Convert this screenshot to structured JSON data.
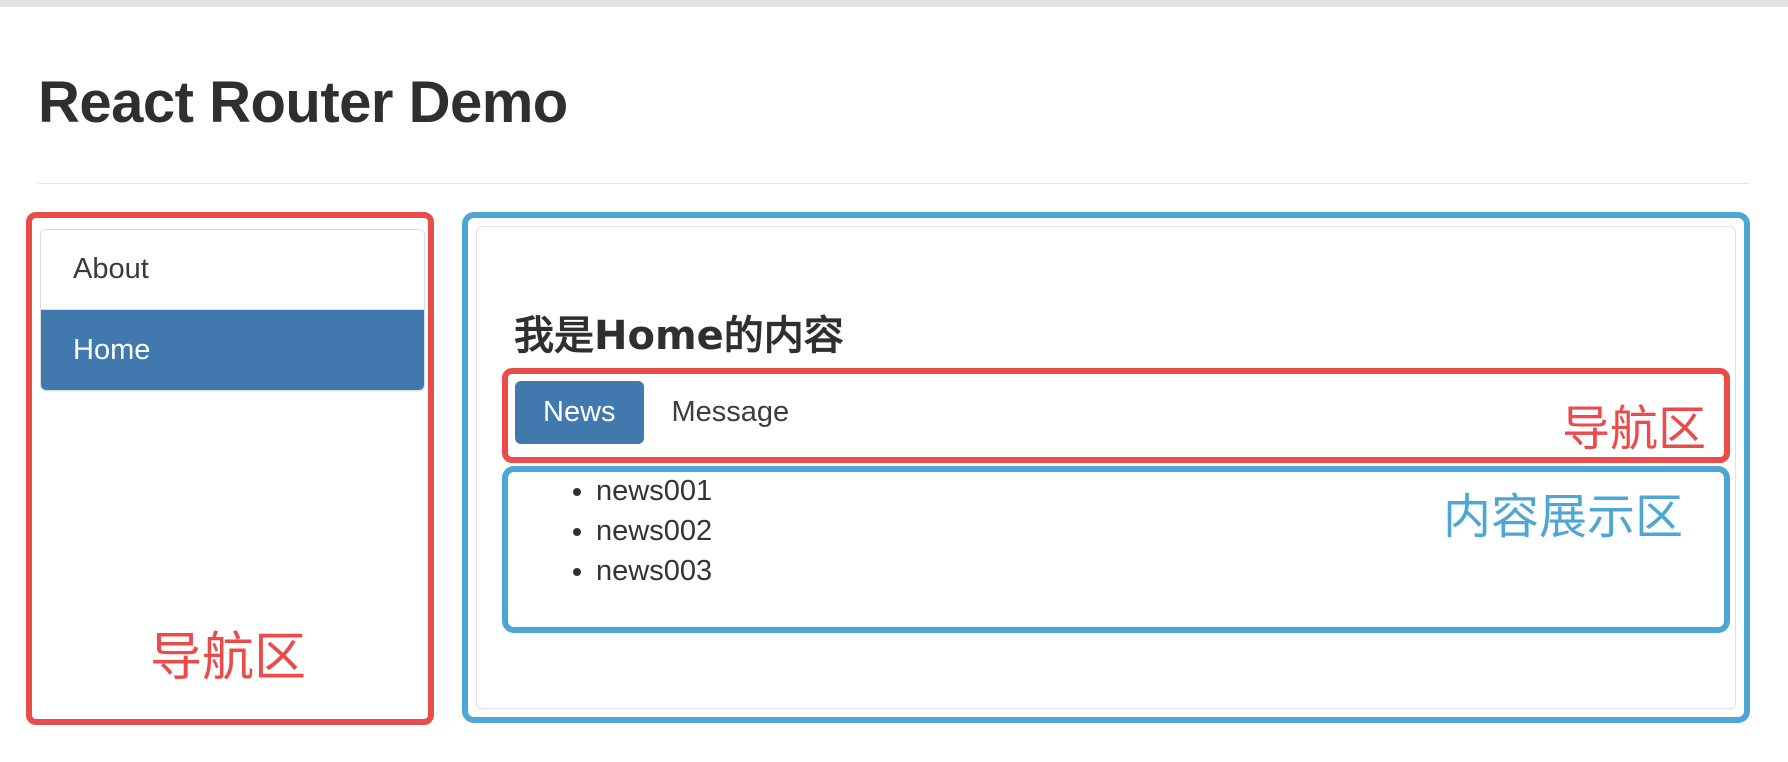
{
  "header": {
    "title": "React Router Demo"
  },
  "sidebar": {
    "items": [
      {
        "label": "About",
        "active": false
      },
      {
        "label": "Home",
        "active": true
      }
    ]
  },
  "content": {
    "heading": "我是Home的内容",
    "tabs": [
      {
        "label": "News",
        "active": true
      },
      {
        "label": "Message",
        "active": false
      }
    ],
    "news_items": [
      "news001",
      "news002",
      "news003"
    ]
  },
  "annotations": {
    "nav_area_left": "导航区",
    "content_area_right": "内容展示区",
    "nav_area_tabs": "导航区",
    "content_area_list": "内容展示区"
  },
  "colors": {
    "annotation_red": "#ea4c4c",
    "annotation_blue": "#4ea6d4",
    "active_blue": "#4178ae",
    "text_dark": "#2f2f2f",
    "top_strip": "#e3e3e5"
  }
}
